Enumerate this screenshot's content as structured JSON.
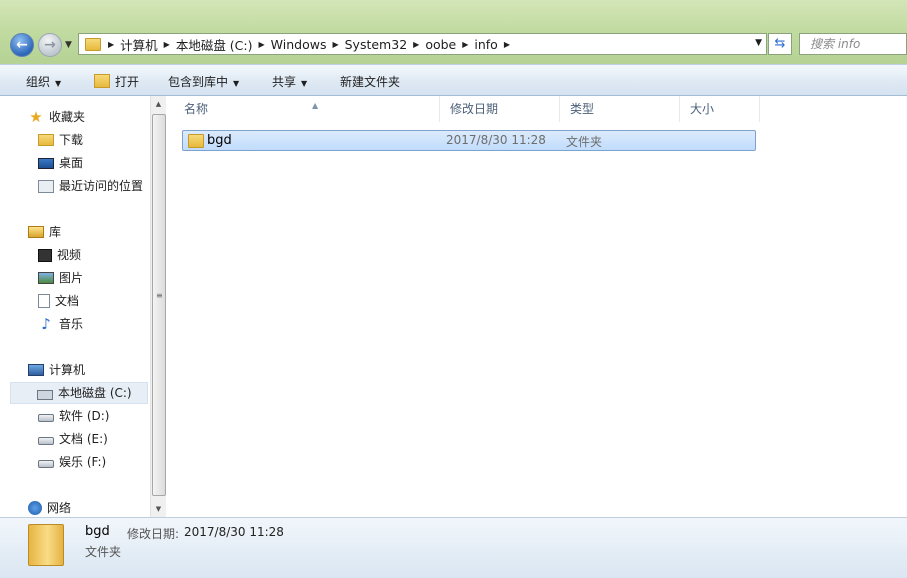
{
  "address": {
    "segments": [
      "计算机",
      "本地磁盘 (C:)",
      "Windows",
      "System32",
      "oobe",
      "info"
    ]
  },
  "search": {
    "placeholder": "搜索 info"
  },
  "toolbar": {
    "organize": "组织",
    "open": "打开",
    "include_library": "包含到库中",
    "share": "共享",
    "new_folder": "新建文件夹"
  },
  "nav": {
    "favorites": "收藏夹",
    "downloads": "下载",
    "desktop": "桌面",
    "recent": "最近访问的位置",
    "libraries": "库",
    "videos": "视频",
    "pictures": "图片",
    "documents": "文档",
    "music": "音乐",
    "computer": "计算机",
    "drive_c": "本地磁盘 (C:)",
    "drive_d": "软件 (D:)",
    "drive_e": "文档 (E:)",
    "drive_f": "娱乐 (F:)",
    "network": "网络"
  },
  "columns": {
    "name": "名称",
    "modified": "修改日期",
    "type": "类型",
    "size": "大小"
  },
  "files": [
    {
      "name": "bgd",
      "modified": "2017/8/30 11:28",
      "type": "文件夹"
    }
  ],
  "details": {
    "name": "bgd",
    "date_label": "修改日期:",
    "date": "2017/8/30 11:28",
    "type": "文件夹"
  },
  "icons": {
    "back": "back-arrow-icon",
    "forward": "forward-arrow-icon",
    "refresh": "refresh-icon",
    "favorites": "star-icon"
  }
}
